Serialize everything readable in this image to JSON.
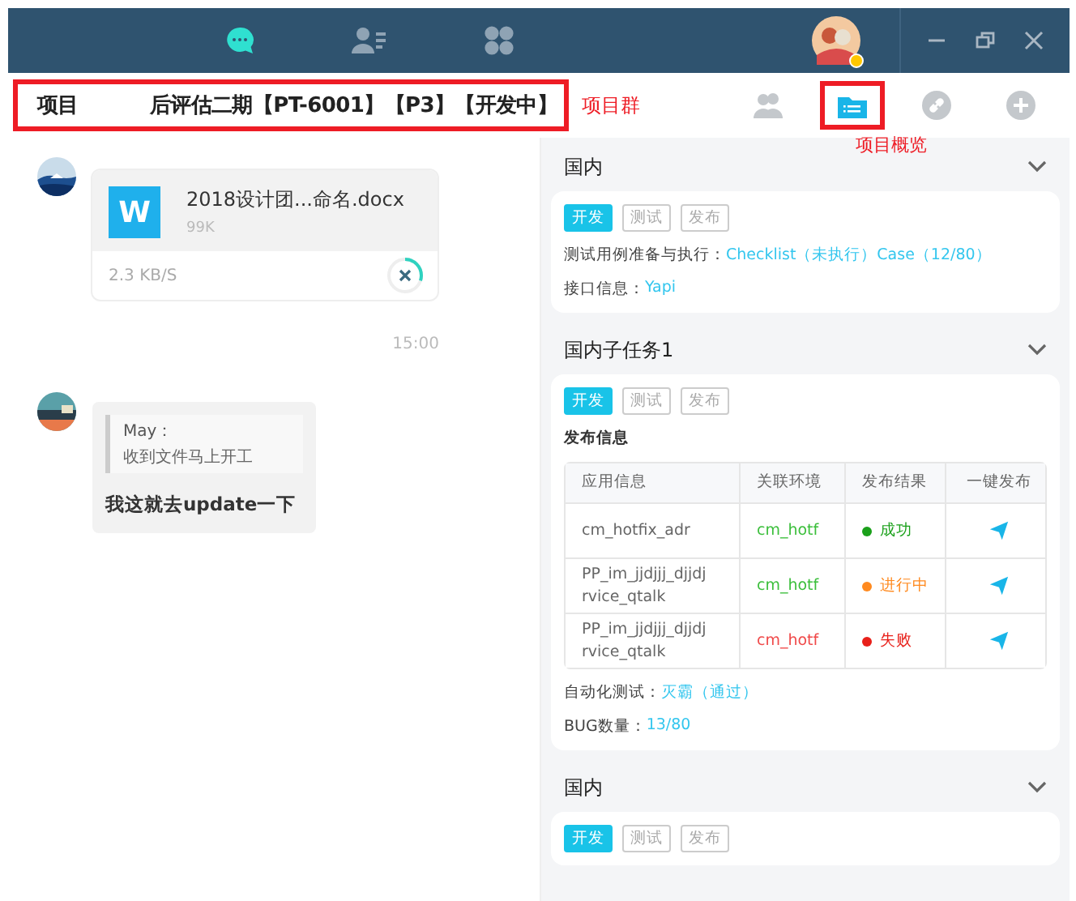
{
  "top_bar": {
    "nav": [
      {
        "kind": "chat",
        "selected": true
      },
      {
        "kind": "contacts",
        "selected": false
      },
      {
        "kind": "apps",
        "selected": false
      }
    ],
    "avatar": {
      "online": true
    }
  },
  "header": {
    "title_parts": [
      "项目",
      "后评估二期【PT-6001】【P3】【开发中】"
    ],
    "title_note": "项目群",
    "tools": [
      {
        "kind": "members",
        "selected": false
      },
      {
        "kind": "overview",
        "selected": true
      },
      {
        "kind": "link",
        "selected": false
      },
      {
        "kind": "add",
        "selected": false
      }
    ],
    "tool_note": "项目概览"
  },
  "chat": {
    "messages": [
      {
        "kind": "file",
        "file_letter": "W",
        "file_name": "2018设计团...命名.docx",
        "file_size": "99K",
        "speed": "2.3 KB/S"
      },
      {
        "kind": "time",
        "text": "15:00"
      },
      {
        "kind": "reply",
        "quote_author": "May：",
        "quote_text": "收到文件马上开工",
        "text": "我这就去update一下"
      }
    ]
  },
  "panel": {
    "sections": [
      {
        "title": "国内",
        "expanded": true,
        "stages": [
          {
            "label": "开发",
            "selected": true
          },
          {
            "label": "测试",
            "selected": false
          },
          {
            "label": "发布",
            "selected": false
          }
        ],
        "info": [
          {
            "label": "测试用例准备与执行：",
            "value": "Checklist（未执行）Case（12/80）"
          },
          {
            "label": "接口信息：",
            "value": "Yapi"
          }
        ]
      },
      {
        "title": "国内子任务1",
        "expanded": true,
        "stages": [
          {
            "label": "开发",
            "selected": true
          },
          {
            "label": "测试",
            "selected": false
          },
          {
            "label": "发布",
            "selected": false
          }
        ],
        "release": {
          "title": "发布信息",
          "columns": [
            "应用信息",
            "关联环境",
            "发布结果",
            "一键发布"
          ],
          "rows": [
            {
              "app": "cm_hotfix_adr",
              "env": "cm_hotf",
              "env_failed": false,
              "status": "成功",
              "color": "#1aa01a"
            },
            {
              "app": "PP_im_jjdjjj_djjdj rvice_qtalk",
              "env": "cm_hotf",
              "env_failed": false,
              "status": "进行中",
              "color": "#ff8a1f"
            },
            {
              "app": "PP_im_jjdjjj_djjdj rvice_qtalk",
              "env": "cm_hotf",
              "env_failed": true,
              "status": "失败",
              "color": "#e8201a"
            }
          ]
        },
        "info": [
          {
            "label": "自动化测试：",
            "value": "灭霸（通过）"
          },
          {
            "label": "BUG数量：",
            "value": "13/80"
          }
        ]
      },
      {
        "title": "国内",
        "expanded": true,
        "stages": [
          {
            "label": "开发",
            "selected": true
          },
          {
            "label": "测试",
            "selected": false
          },
          {
            "label": "发布",
            "selected": false
          }
        ]
      }
    ]
  }
}
